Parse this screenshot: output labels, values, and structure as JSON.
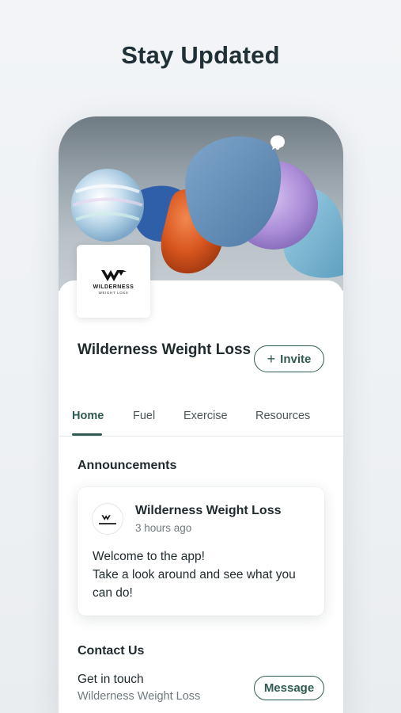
{
  "headline": "Stay Updated",
  "cover": {
    "icons": [
      "chat-icon",
      "bell-icon"
    ]
  },
  "logo": {
    "word": "WILDERNESS",
    "sub": "WEIGHT LOSS"
  },
  "group": {
    "title": "Wilderness Weight Loss",
    "invite_label": "Invite"
  },
  "tabs": [
    {
      "label": "Home",
      "active": true
    },
    {
      "label": "Fuel",
      "active": false
    },
    {
      "label": "Exercise",
      "active": false
    },
    {
      "label": "Resources",
      "active": false
    }
  ],
  "announcements": {
    "title": "Announcements",
    "post": {
      "author": "Wilderness Weight Loss",
      "time": "3 hours ago",
      "lines": [
        "Welcome to the app!",
        "Take a look around and see what you",
        "can do!"
      ]
    }
  },
  "contact": {
    "title": "Contact Us",
    "line1": "Get in touch",
    "line2": "Wilderness Weight Loss",
    "button_label": "Message"
  },
  "colors": {
    "accent": "#2f5a52",
    "text": "#1f2a2e",
    "muted": "#6f7a7e"
  }
}
